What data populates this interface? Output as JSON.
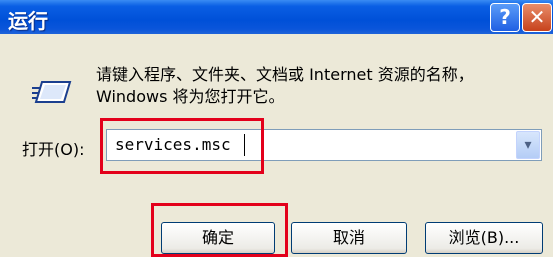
{
  "window": {
    "title": "运行"
  },
  "titlebar_buttons": {
    "help": "?",
    "close": "✕"
  },
  "description": "请键入程序、文件夹、文档或 Internet 资源的名称，Windows 将为您打开它。",
  "open": {
    "label": "打开(O):",
    "value": "services.msc"
  },
  "buttons": {
    "ok": "确定",
    "cancel": "取消",
    "browse": "浏览(B)..."
  },
  "colors": {
    "highlight": "#E3001B",
    "titlebar": "#0050D8"
  }
}
